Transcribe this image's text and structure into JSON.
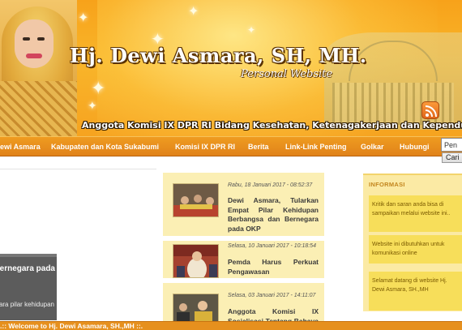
{
  "header": {
    "title": "Hj. Dewi Asmara, SH, MH.",
    "subtitle": "Personal Website",
    "tagline": "Anggota Komisi IX DPR RI Bidang Kesehatan, Ketenagakerjaan dan Kependudukan."
  },
  "nav": {
    "items": [
      "ewi Asmara",
      "Kabupaten dan Kota Sukabumi",
      "Komisi IX DPR RI",
      "Berita",
      "Link-Link Penting",
      "Golkar",
      "Hubungi"
    ]
  },
  "search": {
    "value": "Pen",
    "button_label": "Cari"
  },
  "slider": {
    "title": "Empat Pilar Bernegara pada",
    "body": "ewi Asmara pilar kehidupan"
  },
  "news": [
    {
      "date": "Rabu, 18 Januari 2017 - 08:52:37",
      "headline": "Dewi Asmara, Tularkan Empat Pilar Kehidupan Berbangsa dan Bernegara pada OKP"
    },
    {
      "date": "Selasa, 10 Januari 2017 - 10:18:54",
      "headline": "Pemda Harus Perkuat Pengawasan"
    },
    {
      "date": "Selasa, 03 Januari 2017 - 14:11:07",
      "headline": "Anggota Komisi IX Sosialisasi Tentang Bahaya Kosmetik dan Obat Tanpa Label"
    }
  ],
  "sidebar": {
    "heading": "Informasi",
    "cards": [
      "Kritik dan saran anda bisa di sampaikan melalui website ini..",
      "Website ini dibutuhkan untuk komunikasi online",
      "Selamat datang di website Hj. Dewi Asmara, SH.,MH"
    ]
  },
  "footer": {
    "marquee": ".:: Welcome to Hj. Dewi Asamara, SH.,MH ::."
  },
  "colors": {
    "nav_bg": "#e98e1c",
    "info_card": "#f7de5a",
    "news_bg": "#fbefb4",
    "slider_bg": "#5c5c5c"
  }
}
